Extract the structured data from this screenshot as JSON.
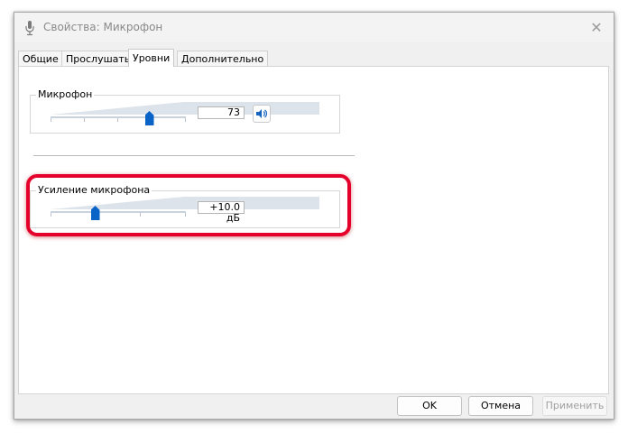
{
  "window": {
    "title": "Свойства: Микрофон",
    "close_glyph": "✕"
  },
  "tabs": [
    {
      "label": "Общие",
      "active": false
    },
    {
      "label": "Прослушать",
      "active": false
    },
    {
      "label": "Уровни",
      "active": true
    },
    {
      "label": "Дополнительно",
      "active": false
    }
  ],
  "levels": {
    "microphone": {
      "label": "Микрофон",
      "value": "73",
      "level_percent": 73,
      "speaker_icon": "speaker-icon"
    },
    "boost": {
      "label": "Усиление микрофона",
      "value": "+10.0 дБ",
      "level_percent": 33
    }
  },
  "buttons": {
    "ok": "OK",
    "cancel": "Отмена",
    "apply": "Применить"
  },
  "colors": {
    "accent": "#0a64c8",
    "highlight": "#e4002b"
  }
}
